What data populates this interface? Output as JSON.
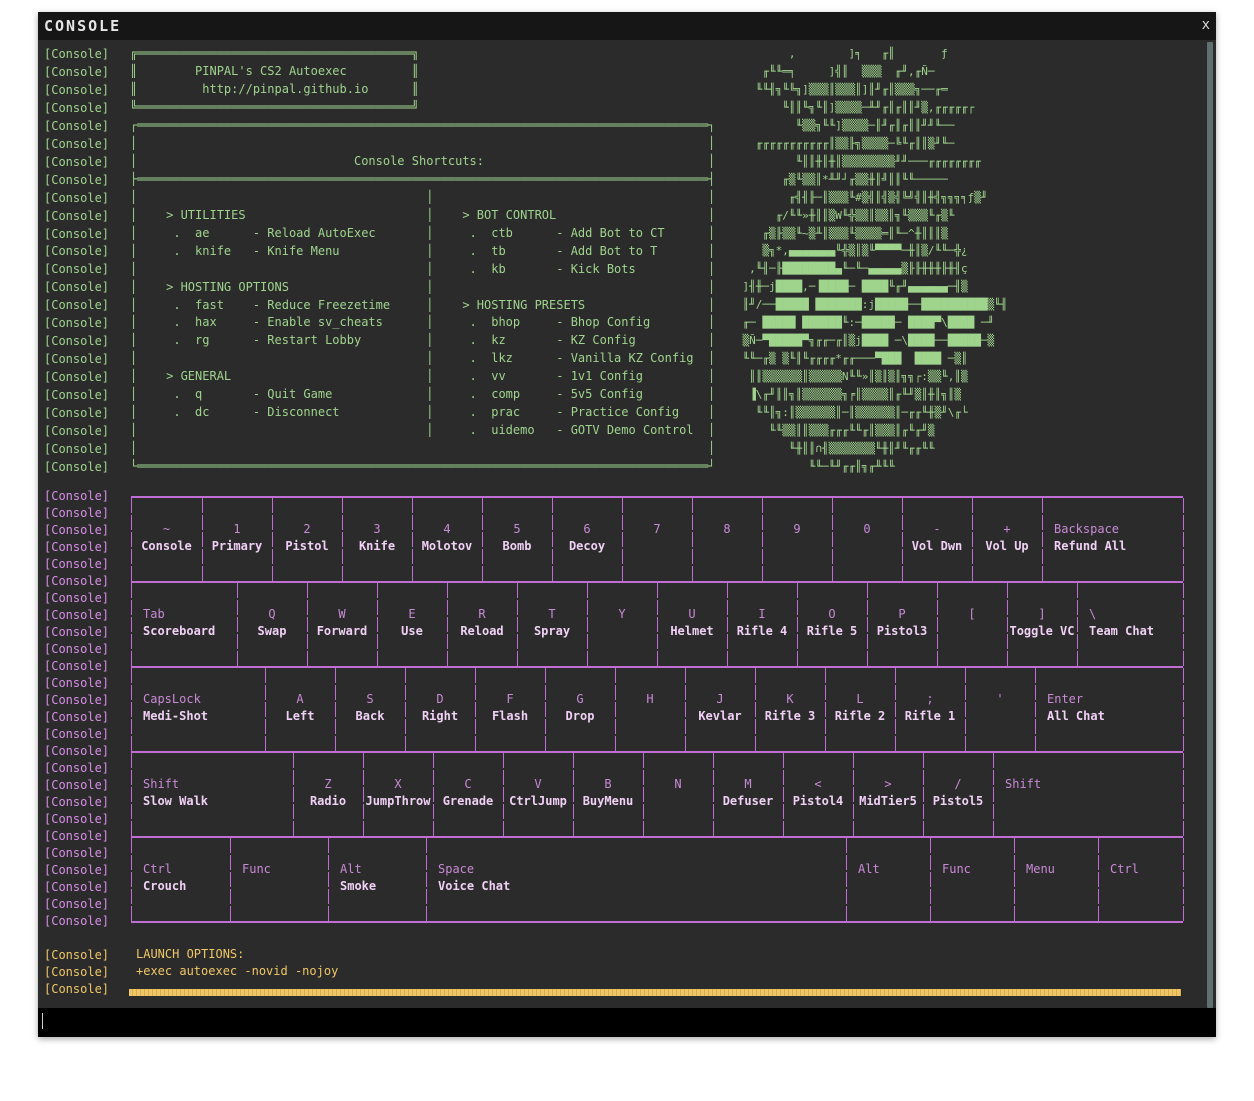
{
  "window": {
    "title": "CONSOLE",
    "close_label": "x"
  },
  "prefix": "[Console]",
  "header_box": {
    "lines": [
      "╔══════════════════════════════════════╗",
      "║        PINPAL's CS2 Autoexec         ║",
      "║         http://pinpal.github.io      ║",
      "╚══════════════════════════════════════╝"
    ]
  },
  "shortcuts_box": {
    "lines": [
      "┌═══════════════════════════════════════════════════════════════════════════════┐",
      "│                                                                               │",
      "│                              Console Shortcuts:                               │",
      "├═══════════════════════════════════════════════════════════════════════════════┤",
      "│                                        │                                      │",
      "│    > UTILITIES                         │    > BOT CONTROL                     │",
      "│     .  ae      - Reload AutoExec       │     .  ctb      - Add Bot to CT      │",
      "│     .  knife   - Knife Menu            │     .  tb       - Add Bot to T       │",
      "│                                        │     .  kb       - Kick Bots          │",
      "│    > HOSTING OPTIONS                   │                                      │",
      "│     .  fast    - Reduce Freezetime     │    > HOSTING PRESETS                 │",
      "│     .  hax     - Enable sv_cheats      │     .  bhop     - Bhop Config        │",
      "│     .  rg      - Restart Lobby         │     .  kz       - KZ Config          │",
      "│                                        │     .  lkz      - Vanilla KZ Config  │",
      "│    > GENERAL                           │     .  vv       - 1v1 Config         │",
      "│     .  q       - Quit Game             │     .  comp     - 5v5 Config         │",
      "│     .  dc      - Disconnect            │     .  prac     - Practice Config    │",
      "│                                        │     .  uidemo   - GOTV Demo Control  │",
      "│                                                                               │",
      "└═══════════════════════════════════════════════════════════════════════════════┘"
    ]
  },
  "logo_art": {
    "lines": [
      "           ,        ]╕   ╓║       ƒ",
      "       ╓╙╙═╕     ]╣║  ▒▒▒  ╓╜,╓Ñ─",
      "      ╙╙╢╗╙╚╗]▒▒▒║▒▒▒║]║╜╓║▒▒▒╗──╓═",
      "          ╙║║╙╗╙║]▒▒▒▒─╨╜╓║╓║║╜▒,╓╓╓╓╓┌",
      "            ╙▒▒╗╙╙]▒▒▒▒─║╜╓║╓║║╜╜╙──",
      "      ╓╓╓╓╓╓╓╓╓╓╓║▒▒╟╗▒▒▒▒─╚╙╓║║▒╜╙─",
      "            ╙║║╫║╫║▒▒▒▒▒▒▒▒╜╜───╓╓╓╓╓╓╓╓",
      "          ╓▒╙▒▒║*╨╜┘╓▒▒╫║╝║║╙╙─────",
      "           ╓╣╢╟─║▒▒▒╙#▒╣║╣▒╣╚╝╣║╫╣╗╗╗╕ƒ▒╜",
      "         ╓/╙╙»╫║║▒W╙╬▒▒║▒▒║╗╙▒▒▒╙╓▒╙",
      "       ╓▒╟▒▒╙~▒╨║▒▒▒╙▒▒▒▒═║╙─^╫║║║▒",
      "       ▒╗*,▄▄▄▄▄▄▄╙╬▒║▒╙▀▀▀▀─╫║▒/╙╙─╬¿",
      "     ,╙╢─╟████████▄╙─╙─▄▄▄▄▄▒╟╟╫╫╫╟╫╢ç",
      "    ]╢╫─j████,─▐████─ ████╙╓╜▄▄▄▄▄▄─╢▒",
      "    ║╜/──█████ ███████:j█████──██████████▒╙╢",
      "    ╓─ █████ ██████╙:─█████─ ████▀\\████ ─╜",
      "    ▒Ñ─▀█████▀╗╓╓─╓║▒j████ ─\\████──█████─▒",
      "    ╙╙─╓▒ ▒╙║╙╓╓╓╓*╓╓───▀███  ████ ─▒║",
      "     ║║▒▒▒▒▒▒║▒▒▒▒▒N╙╙»║▒║▒║╗╗┌:▒▒╙,║▒",
      "     ▐\\╓╜║║╗║▒▒▒▒▒▒╗╒║▒▒▒▒║╓╙╜▒║╫║╗║▒",
      "      ╙╙║╗:║▒▒▒▒▒▒║─║▒▒▒▒▒▒║─╓╓╙╫▒╜\\╓└",
      "        ╙╙▒▒║║▒▒▒╓╓╓╙╙╓║▒▒▒║╓╙╓╜▒",
      "           ╙╫║║∩╢▒▒▒▒▒▒▒╙╫║╜╙╓╓╙╙",
      "              ╙╙─╙╜╓╓║╗╓╨╙╙"
    ]
  },
  "keyboard": {
    "rows": [
      {
        "keys": [
          {
            "top": "~",
            "bot": "Console"
          },
          {
            "top": "1",
            "bot": "Primary"
          },
          {
            "top": "2",
            "bot": "Pistol"
          },
          {
            "top": "3",
            "bot": "Knife"
          },
          {
            "top": "4",
            "bot": "Molotov"
          },
          {
            "top": "5",
            "bot": "Bomb"
          },
          {
            "top": "6",
            "bot": "Decoy"
          },
          {
            "top": "7",
            "bot": ""
          },
          {
            "top": "8",
            "bot": ""
          },
          {
            "top": "9",
            "bot": ""
          },
          {
            "top": "0",
            "bot": ""
          },
          {
            "top": "-",
            "bot": "Vol Dwn"
          },
          {
            "top": "+",
            "bot": "Vol Up"
          },
          {
            "top": "Backspace",
            "bot": "Refund All"
          }
        ]
      },
      {
        "keys": [
          {
            "top": "Tab",
            "bot": "Scoreboard"
          },
          {
            "top": "Q",
            "bot": "Swap"
          },
          {
            "top": "W",
            "bot": "Forward"
          },
          {
            "top": "E",
            "bot": "Use"
          },
          {
            "top": "R",
            "bot": "Reload"
          },
          {
            "top": "T",
            "bot": "Spray"
          },
          {
            "top": "Y",
            "bot": ""
          },
          {
            "top": "U",
            "bot": "Helmet"
          },
          {
            "top": "I",
            "bot": "Rifle 4"
          },
          {
            "top": "O",
            "bot": "Rifle 5"
          },
          {
            "top": "P",
            "bot": "Pistol3"
          },
          {
            "top": "[",
            "bot": ""
          },
          {
            "top": "]",
            "bot": "Toggle VC"
          },
          {
            "top": "\\",
            "bot": "Team Chat"
          }
        ]
      },
      {
        "keys": [
          {
            "top": "CapsLock",
            "bot": "Medi-Shot"
          },
          {
            "top": "A",
            "bot": "Left"
          },
          {
            "top": "S",
            "bot": "Back"
          },
          {
            "top": "D",
            "bot": "Right"
          },
          {
            "top": "F",
            "bot": "Flash"
          },
          {
            "top": "G",
            "bot": "Drop"
          },
          {
            "top": "H",
            "bot": ""
          },
          {
            "top": "J",
            "bot": "Kevlar"
          },
          {
            "top": "K",
            "bot": "Rifle 3"
          },
          {
            "top": "L",
            "bot": "Rifle 2"
          },
          {
            "top": ";",
            "bot": "Rifle 1"
          },
          {
            "top": "'",
            "bot": ""
          },
          {
            "top": "Enter",
            "bot": "All Chat"
          }
        ]
      },
      {
        "keys": [
          {
            "top": "Shift",
            "bot": "Slow Walk"
          },
          {
            "top": "Z",
            "bot": "Radio"
          },
          {
            "top": "X",
            "bot": "JumpThrow"
          },
          {
            "top": "C",
            "bot": "Grenade"
          },
          {
            "top": "V",
            "bot": "CtrlJump"
          },
          {
            "top": "B",
            "bot": "BuyMenu"
          },
          {
            "top": "N",
            "bot": ""
          },
          {
            "top": "M",
            "bot": "Defuser"
          },
          {
            "top": "<",
            "bot": "Pistol4"
          },
          {
            "top": ">",
            "bot": "MidTier5"
          },
          {
            "top": "/",
            "bot": "Pistol5"
          },
          {
            "top": "Shift",
            "bot": ""
          }
        ]
      },
      {
        "keys": [
          {
            "top": "Ctrl",
            "bot": "Crouch"
          },
          {
            "top": "Func",
            "bot": ""
          },
          {
            "top": "Alt",
            "bot": "Smoke"
          },
          {
            "top": "Space",
            "bot": "Voice Chat"
          },
          {
            "top": "Alt",
            "bot": ""
          },
          {
            "top": "Func",
            "bot": ""
          },
          {
            "top": "Menu",
            "bot": ""
          },
          {
            "top": "Ctrl",
            "bot": ""
          }
        ]
      }
    ]
  },
  "launch": {
    "label": "LAUNCH OPTIONS:",
    "value": "+exec autoexec -novid -nojoy"
  },
  "colors": {
    "green": "#9fd48d",
    "purple": "#d88ee8",
    "gold": "#f0c766",
    "background": "#2b2b2b"
  }
}
